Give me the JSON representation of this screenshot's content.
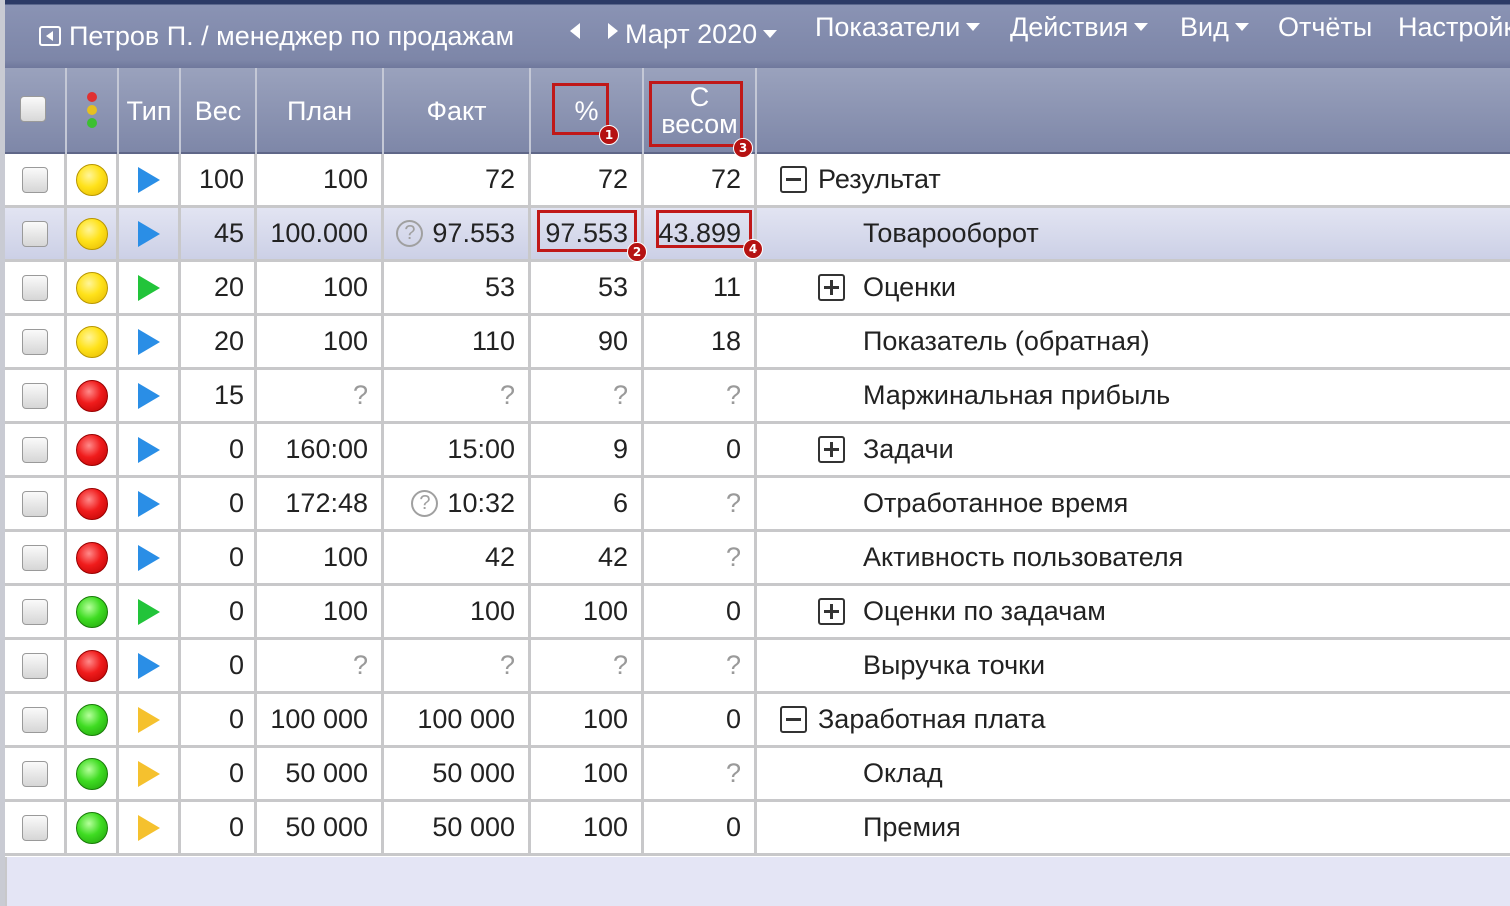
{
  "topbar": {
    "user": "Петров П. / менеджер по продажам",
    "period": "Март 2020",
    "menu": [
      "Показатели",
      "Действия",
      "Вид",
      "Отчёты",
      "Настройки"
    ]
  },
  "header": {
    "type": "Тип",
    "weight": "Вес",
    "plan": "План",
    "fact": "Факт",
    "percent": "%",
    "weighted_line1": "С",
    "weighted_line2": "весом"
  },
  "annotations": [
    "1",
    "2",
    "3",
    "4"
  ],
  "rows": [
    {
      "light": "yellow",
      "type": "blue",
      "weight": "100",
      "plan": "100",
      "fact": "72",
      "percent": "72",
      "weighted": "72",
      "name": "Результат",
      "expander": "minus",
      "indent": 0
    },
    {
      "light": "yellow",
      "type": "blue",
      "weight": "45",
      "plan": "100.000",
      "fact": "97.553",
      "fact_help": true,
      "percent": "97.553",
      "weighted": "43.899",
      "name": "Товарооборот",
      "expander": "",
      "indent": 1,
      "selected": true
    },
    {
      "light": "yellow",
      "type": "green",
      "weight": "20",
      "plan": "100",
      "fact": "53",
      "percent": "53",
      "weighted": "11",
      "name": "Оценки",
      "expander": "plus",
      "indent": 1
    },
    {
      "light": "yellow",
      "type": "blue",
      "weight": "20",
      "plan": "100",
      "fact": "110",
      "percent": "90",
      "weighted": "18",
      "name": "Показатель (обратная)",
      "expander": "",
      "indent": 1
    },
    {
      "light": "red",
      "type": "blue",
      "weight": "15",
      "plan": "?",
      "fact": "?",
      "percent": "?",
      "weighted": "?",
      "name": "Маржинальная прибыль",
      "expander": "",
      "indent": 1
    },
    {
      "light": "red",
      "type": "blue",
      "weight": "0",
      "plan": "160:00",
      "fact": "15:00",
      "percent": "9",
      "weighted": "0",
      "name": "Задачи",
      "expander": "plus",
      "indent": 1
    },
    {
      "light": "red",
      "type": "blue",
      "weight": "0",
      "plan": "172:48",
      "fact": "10:32",
      "fact_help": true,
      "percent": "6",
      "weighted": "?",
      "name": "Отработанное время",
      "expander": "",
      "indent": 1
    },
    {
      "light": "red",
      "type": "blue",
      "weight": "0",
      "plan": "100",
      "fact": "42",
      "percent": "42",
      "weighted": "?",
      "name": "Активность пользователя",
      "expander": "",
      "indent": 1
    },
    {
      "light": "green",
      "type": "green",
      "weight": "0",
      "plan": "100",
      "fact": "100",
      "percent": "100",
      "weighted": "0",
      "name": "Оценки по задачам",
      "expander": "plus",
      "indent": 1
    },
    {
      "light": "red",
      "type": "blue",
      "weight": "0",
      "plan": "?",
      "fact": "?",
      "percent": "?",
      "weighted": "?",
      "name": "Выручка точки",
      "expander": "",
      "indent": 1
    },
    {
      "light": "green",
      "type": "orange",
      "weight": "0",
      "plan": "100 000",
      "fact": "100 000",
      "percent": "100",
      "weighted": "0",
      "name": "Заработная плата",
      "expander": "minus",
      "indent": 0
    },
    {
      "light": "green",
      "type": "orange",
      "weight": "0",
      "plan": "50 000",
      "fact": "50 000",
      "percent": "100",
      "weighted": "?",
      "name": "Оклад",
      "expander": "",
      "indent": 1
    },
    {
      "light": "green",
      "type": "orange",
      "weight": "0",
      "plan": "50 000",
      "fact": "50 000",
      "percent": "100",
      "weighted": "0",
      "name": "Премия",
      "expander": "",
      "indent": 1
    }
  ]
}
